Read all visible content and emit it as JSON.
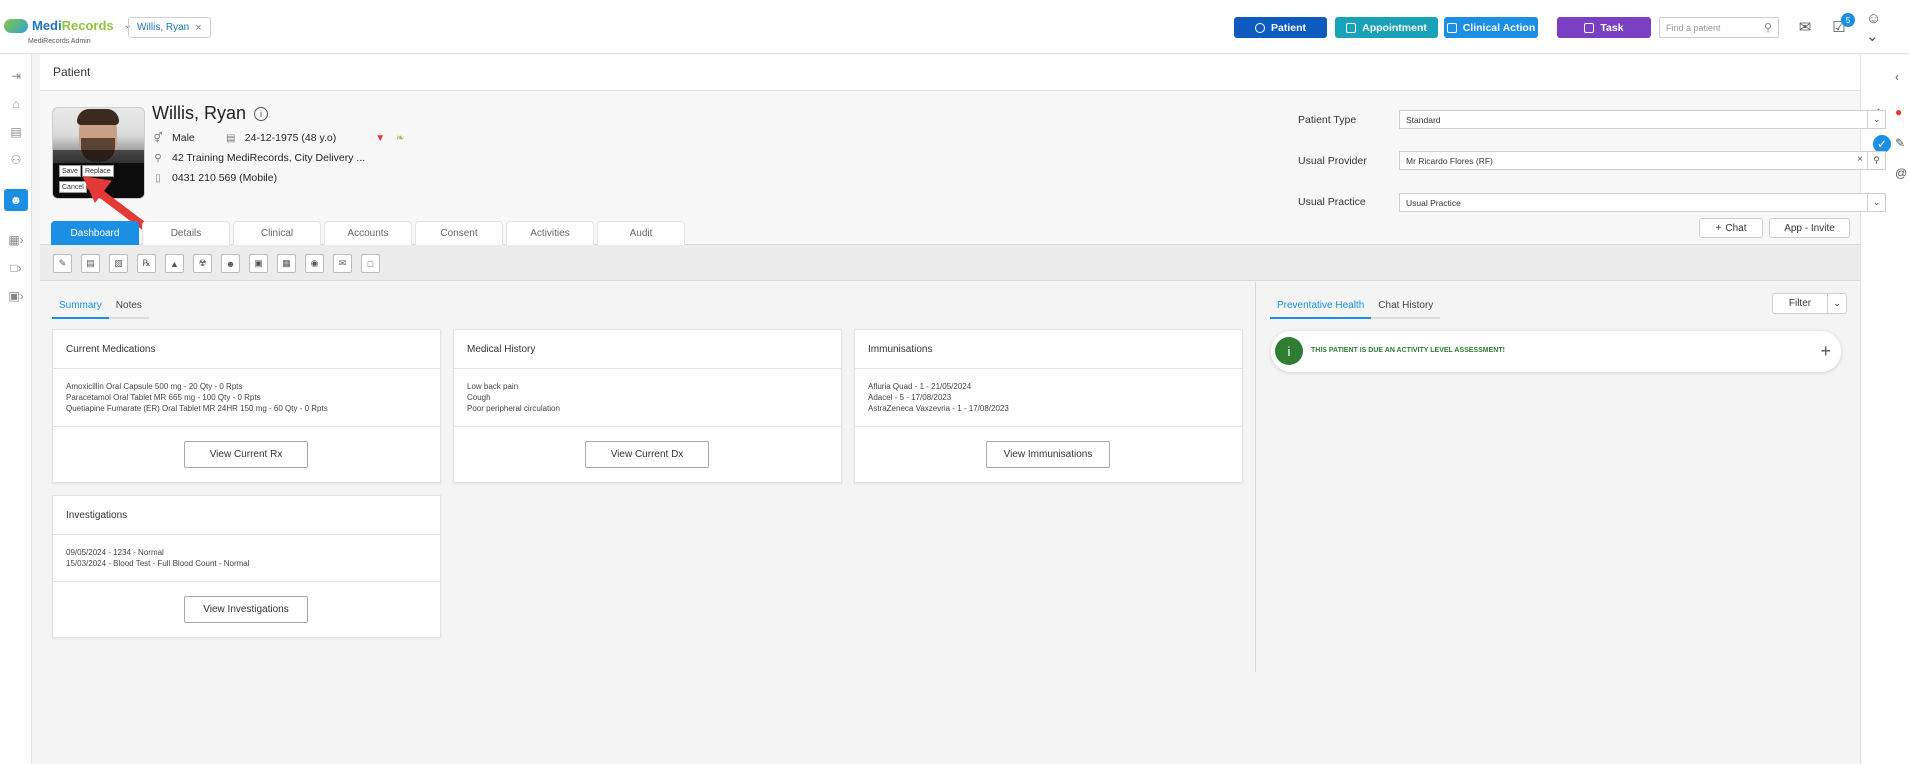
{
  "app": {
    "logo_main": "Medi",
    "logo_accent": "Records",
    "logo_sub": "MediRecords Admin",
    "patient_chip": "Willis, Ryan"
  },
  "header_buttons": [
    {
      "label": "Patient",
      "color": "#0d5bbf"
    },
    {
      "label": "Appointment",
      "color": "#17a2b8"
    },
    {
      "label": "Clinical Action",
      "color": "#1a8fe3"
    },
    {
      "label": "Task",
      "color": "#7b3fc4"
    }
  ],
  "search": {
    "placeholder": "Find a patient"
  },
  "notifications": {
    "count": "5"
  },
  "page": {
    "title": "Patient"
  },
  "patient": {
    "name": "Willis, Ryan",
    "gender": "Male",
    "dob": "24-12-1975 (48 y.o)",
    "address": "42 Training MediRecords, City Delivery ...",
    "phone": "0431 210 569 (Mobile)",
    "photo_actions": {
      "save": "Save",
      "replace": "Replace",
      "cancel": "Cancel"
    }
  },
  "fields": {
    "patient_type": {
      "label": "Patient Type",
      "value": "Standard"
    },
    "usual_provider": {
      "label": "Usual Provider",
      "value": "Mr Ricardo Flores (RF)"
    },
    "usual_practice": {
      "label": "Usual Practice",
      "value": "Usual Practice"
    }
  },
  "actions": {
    "chat": "Chat",
    "app_invite": "App - Invite"
  },
  "tabs": [
    "Dashboard",
    "Details",
    "Clinical",
    "Accounts",
    "Consent",
    "Activities",
    "Audit"
  ],
  "summary_tabs": [
    "Summary",
    "Notes"
  ],
  "right_tabs": [
    "Preventative Health",
    "Chat History"
  ],
  "filter": {
    "label": "Filter"
  },
  "cards": {
    "medications": {
      "title": "Current Medications",
      "lines": [
        "Amoxicillin Oral Capsule 500 mg - 20 Qty - 0 Rpts",
        "Paracetamol Oral Tablet MR 665 mg - 100 Qty - 0 Rpts",
        "Quetiapine Fumarate (ER) Oral Tablet MR 24HR 150 mg - 60 Qty - 0 Rpts"
      ],
      "button": "View Current Rx"
    },
    "history": {
      "title": "Medical History",
      "lines": [
        "Low back pain",
        "Cough",
        "Poor peripheral circulation"
      ],
      "button": "View Current Dx"
    },
    "immunisations": {
      "title": "Immunisations",
      "lines": [
        "Afluria Quad - 1 - 21/05/2024",
        "Adacel - 5 - 17/08/2023",
        "AstraZeneca Vaxzevria - 1 - 17/08/2023"
      ],
      "button": "View Immunisations"
    },
    "investigations": {
      "title": "Investigations",
      "lines": [
        "09/05/2024 - 1234 - Normal",
        "15/03/2024 - Blood Test - Full Blood Count - Normal"
      ],
      "button": "View Investigations"
    }
  },
  "alert": {
    "message": "THIS PATIENT IS DUE AN ACTIVITY LEVEL ASSESSMENT!"
  }
}
